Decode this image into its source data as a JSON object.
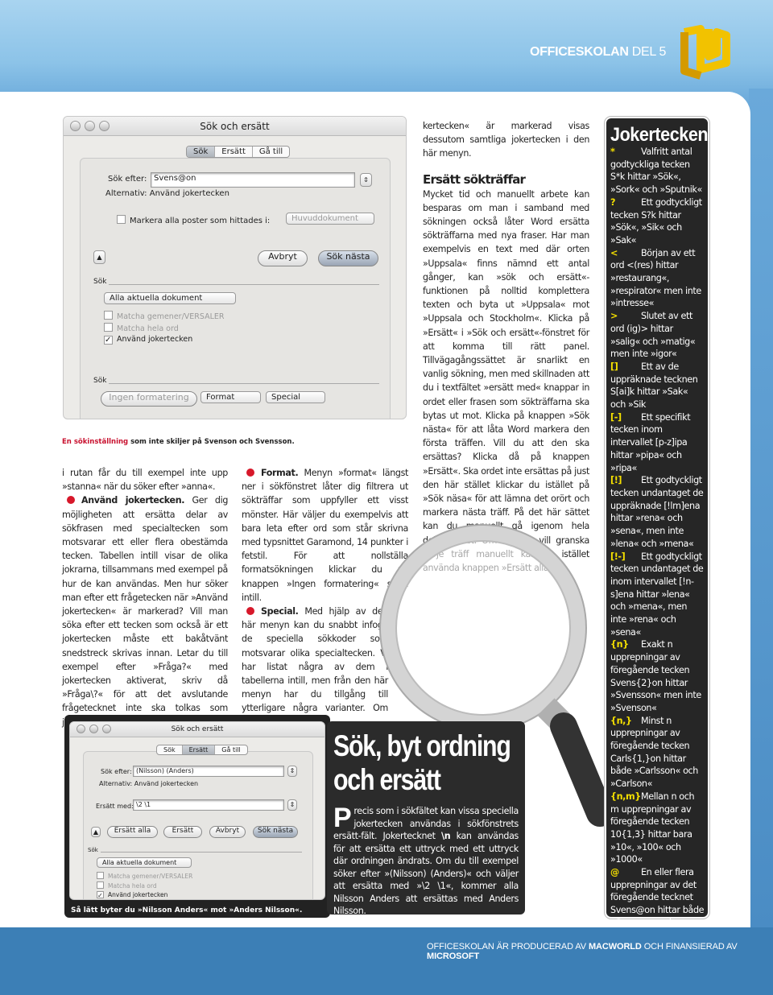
{
  "header": {
    "series": "OFFICESKOLAN",
    "part": "DEL 5",
    "logo_color": "#f2c200"
  },
  "screenshot1": {
    "title": "Sök och ersätt",
    "tabs": [
      "Sök",
      "Ersätt",
      "Gå till"
    ],
    "active_tab": "Sök",
    "find_label": "Sök efter:",
    "find_value": "Svens@on",
    "options_label": "Alternativ:",
    "options_value": "Använd jokertecken",
    "highlight_label": "Markera alla poster som hittades i:",
    "highlight_select": "Huvuddokument",
    "cancel": "Avbryt",
    "find_next": "Sök nästa",
    "section_search": "Sök",
    "scope_select": "Alla aktuella dokument",
    "checkboxes": [
      {
        "label": "Matcha gemener/VERSALER",
        "checked": false,
        "enabled": false
      },
      {
        "label": "Matcha hela ord",
        "checked": false,
        "enabled": false
      },
      {
        "label": "Använd jokertecken",
        "checked": true,
        "enabled": true
      }
    ],
    "section_format": "Sök",
    "no_format": "Ingen formatering",
    "format": "Format",
    "special": "Special"
  },
  "caption1": {
    "highlight": "En sökinställning",
    "rest": " som inte skiljer på Svenson och Svensson."
  },
  "col1": {
    "p1": "i rutan får du till exempel inte upp »stanna« när du söker efter »anna«.",
    "bullet_title": "Använd jokertecken.",
    "bullet_text": " Ger dig möjligheten att ersätta delar av sökfrasen med specialtecken som motsvarar ett eller flera obestämda tecken. Tabellen intill visar de olika jokrarna, tillsammans med exempel på hur de kan användas. Men hur söker man efter ett frågetecken när »Använd jokertecken« är markerad? Vill man söka efter ett tecken som också är ett jokertecken måste ett bakåtvänt snedstreck skrivas innan. Letar du till exempel efter »Fråga?« med jokertecken aktiverat, skriv då »Fråga\\?« för att det avslutande frågetecknet inte ska tolkas som jokertecken."
  },
  "col2": {
    "b1_title": "Format.",
    "b1_text": " Menyn »format« längst ner i sökfönstret låter dig filtrera ut sökträffar som uppfyller ett visst mönster. Här väljer du exempelvis att bara leta efter ord som står skrivna med typsnittet Garamond, 14 punkter i fetstil. För att nollställa formatsökningen klickar du på knappen »Ingen formatering« strax intill.",
    "b2_title": "Special.",
    "b2_text": " Med hjälp av den här menyn kan du snabbt infoga de speciella sökkoder som motsvarar olika specialtecken. Vi har listat några av dem i tabellerna intill, men från den här menyn har du tillgång till ytterligare några varianter. Om rutan »Använd jo-"
  },
  "col3": {
    "p1": "kertecken« är markerad visas dessutom samtliga jokertecken i den här menyn.",
    "heading": "Ersätt sökträffar",
    "p2": "Mycket tid och manuellt arbete kan besparas om man i samband med sökningen också låter Word ersätta sökträffarna med nya fraser. Har man exempelvis en text med där orten »Uppsala« finns nämnd ett antal gånger, kan »sök och ersätt«-funktionen på nolltid komplettera texten och byta ut »Uppsala« mot »Uppsala och Stockholm«. Klicka på »Ersätt« i »Sök och ersätt«-fönstret för att komma till rätt panel. Tillvägagångssättet är snarlikt en vanlig sökning, men med skillnaden att du i textfältet »ersätt med« knappar in ordet eller frasen som sökträffarna ska bytas ut mot. Klicka på knappen »Sök nästa« för att låta Word markera den första träffen. Vill du att den ska ersättas? Klicka då på knappen »Ersätt«. Ska ordet inte ersättas på just den här stället klickar du istället på »Sök näsa« för att lämna det orört och markera nästa träff. På det här sättet kan du manuellt gå igenom hela dokumentet. Om du inte vill granska varje träff manuellt kan du istället använda knappen »Ersätt alla«."
  },
  "screenshot2": {
    "title": "Sök och ersätt",
    "tabs": [
      "Sök",
      "Ersätt",
      "Gå till"
    ],
    "active_tab": "Ersätt",
    "find_label": "Sök efter:",
    "find_value": "(Nilsson) (Anders)",
    "options_label": "Alternativ:",
    "options_value": "Använd jokertecken",
    "replace_label": "Ersätt med:",
    "replace_value": "\\2 \\1",
    "replace_all": "Ersätt alla",
    "replace": "Ersätt",
    "cancel": "Avbryt",
    "find_next": "Sök nästa",
    "section_search": "Sök",
    "scope_select": "Alla aktuella dokument",
    "checkboxes": [
      {
        "label": "Matcha gemener/VERSALER",
        "checked": false
      },
      {
        "label": "Matcha hela ord",
        "checked": false
      },
      {
        "label": "Använd jokertecken",
        "checked": true
      }
    ],
    "caption": "Så lätt byter du »Nilsson Anders« mot »Anders Nilsson«."
  },
  "article": {
    "title": "Sök, byt ordning och ersätt",
    "dropcap": "P",
    "body_1": "recis som i sökfältet kan vissa speciella jokertecken användas i sökfönstrets ersätt-fält. Jokertecknet ",
    "body_code": "\\n",
    "body_2": " kan användas för att ersätta ett uttryck med ett uttryck där ordningen ändrats. Om du till exempel söker efter »(Nilsson) (Anders)« och väljer att ersätta med »\\2 \\1«, kommer alla Nilsson Anders att ersättas med Anders Nilsson."
  },
  "sidebar": {
    "title": "Jokertecken",
    "entries": [
      {
        "symbol": "*",
        "text": "Valfritt antal godtyckliga tecken S*k hittar »Sök«, »Sork« och »Sputnik«"
      },
      {
        "symbol": "?",
        "text": "Ett godtyckligt tecken S?k hittar »Sök«, »Sik« och »Sak«"
      },
      {
        "symbol": "<",
        "text": "Början av ett ord <(res) hittar »restaurang«, »respirator« men inte »intresse«"
      },
      {
        "symbol": ">",
        "text": "Slutet av ett ord (ig)> hittar »salig« och »matig« men inte »igor«"
      },
      {
        "symbol": "[]",
        "text": "Ett av de uppräknade tecknen S[ai]k hittar »Sak« och »Sik"
      },
      {
        "symbol": "[-]",
        "text": "Ett specifikt tecken inom intervallet [p-z]ipa hittar »pipa« och »ripa«"
      },
      {
        "symbol": "[!]",
        "text": "Ett godtyckligt tecken undantaget de uppräknade [!lm]ena hittar »rena« och »sena«, men inte »lena« och »mena«"
      },
      {
        "symbol": "[!-]",
        "text": "Ett godtyckligt tecken undantaget de inom intervallet [!n-s]ena hittar »lena« och »mena«, men inte »rena« och »sena«"
      },
      {
        "symbol": "{n}",
        "text": "Exakt n upprepningar av föregående tecken Svens{2}on hittar »Svensson« men inte »Svenson«"
      },
      {
        "symbol": "{n,}",
        "text": "Minst n upprepningar av föregående tecken Carls{1,}on hittar både »Carlsson« och »Carlson«"
      },
      {
        "symbol": "{n,m}",
        "text": "Mellan n och m upprepningar av föregående tecken 10{1,3} hittar bara »10«, »100« och »1000«"
      },
      {
        "symbol": "@",
        "text": "En eller flera upprepningar av det föregående tecknet Svens@on hittar både »Svenson« och »Svensson«"
      }
    ]
  },
  "footer": {
    "t1": "OFFICESKOLAN ÄR PRODUCERAD AV ",
    "b1": "MACWORLD",
    "t2": " OCH FINANSIERAD AV ",
    "b2": "MICROSOFT"
  }
}
